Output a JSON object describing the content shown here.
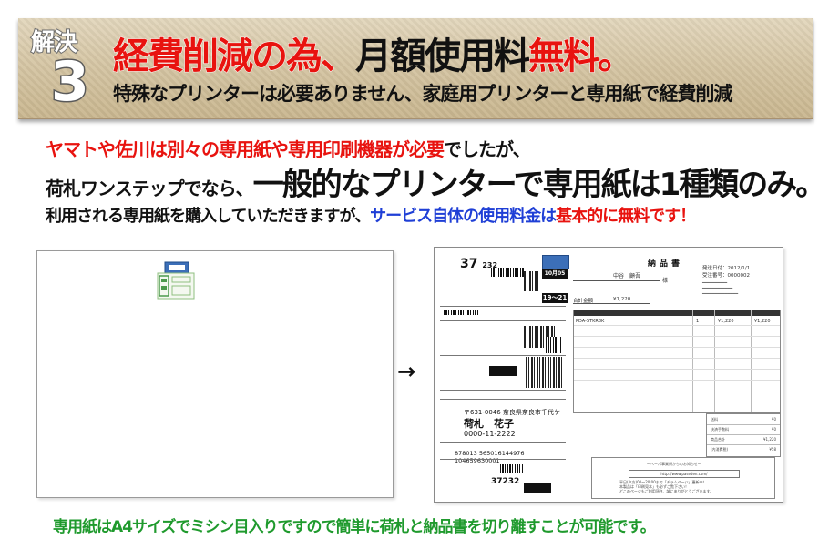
{
  "banner": {
    "badge_word": "解決",
    "badge_number": "3",
    "headline_red_1": "経費削減の為、",
    "headline_black": "月額使用料",
    "headline_red_2": "無料。",
    "subhead": "特殊なプリンターは必要ありません、家庭用プリンターと専用紙で経費削減"
  },
  "body": {
    "line1_red": "ヤマトや佐川は別々の専用紙や専用印刷機器が必要",
    "line1_black": "でしたが、",
    "line2_small": "荷札ワンステップでなら、",
    "line2_big": "一般的なプリンターで専用紙は1種類のみ。",
    "line3_black": "利用される専用紙を購入していただきますが、",
    "line3_blue": "サービス自体の使用料金は",
    "line3_red": "基本的に無料です！"
  },
  "arrow": "→",
  "sample": {
    "code": "37",
    "code_sub": "232",
    "date_label": "10月05日",
    "time_label": "19〜21",
    "recipient_postal": "〒631-0046 奈良県奈良市千代ケ丘2-",
    "recipient_name": "荷札　花子",
    "recipient_phone": "0000-11-2222",
    "tracking": "878013 565016144976 104659630001",
    "bottom_code": "37232",
    "invoice_title": "納品書",
    "invoice_date": "発送日付：2012/1/1",
    "invoice_slip": "受注番号：0000002",
    "invoice_to": "中谷　顧吾",
    "invoice_sama": "様",
    "invoice_total_label": "合計金額",
    "invoice_total_value": "¥1,220",
    "invoice_item": "PDA-STKR8K",
    "invoice_qty": "1",
    "invoice_price": "¥1,220",
    "invoice_amount": "¥1,220",
    "sum_labels": [
      "送料",
      "決済手数料",
      "商品合計",
      "(内消費税)"
    ],
    "sum_values": [
      "¥0",
      "¥0",
      "¥1,220",
      "¥58"
    ],
    "msg_title": "〜ペーパ事業所からのお知らせ〜",
    "msg_url": "http://www.paseden.com/",
    "msg_lines": [
      "平日(夕方)00〜20:00まで「チラムページ」更新中！",
      "本製品は「印刷見本」も必ずご覧下さい！",
      "どこのページもご利用頂き、誠にありがとうございます。"
    ]
  },
  "footer": "専用紙はA4サイズでミシン目入りですので簡単に荷札と納品書を切り離すことが可能です。",
  "colors": {
    "red": "#e8130f",
    "blue": "#1f3fd6",
    "green": "#1f9a2d",
    "banner": "#d4c4a2"
  }
}
